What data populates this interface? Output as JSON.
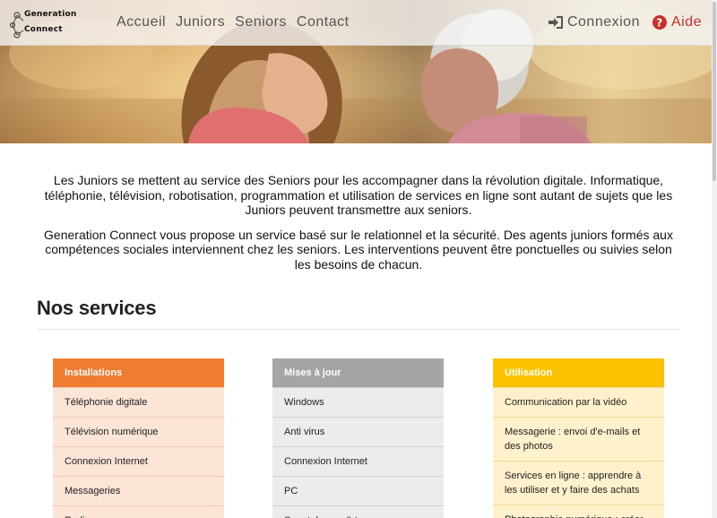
{
  "brand": {
    "line1": "Generation",
    "line2": "Connect"
  },
  "nav": {
    "items": [
      {
        "label": "Accueil"
      },
      {
        "label": "Juniors"
      },
      {
        "label": "Seniors"
      },
      {
        "label": "Contact"
      }
    ],
    "login": {
      "label": "Connexion",
      "icon": "sign-in-icon"
    },
    "help": {
      "label": "Aide",
      "icon": "question-circle-icon",
      "color": "#c9302c"
    }
  },
  "intro": {
    "paragraph1": "Les Juniors se mettent au service des Seniors pour les accompagner dans la révolution digitale. Informatique, téléphonie, télévision, robotisation, programmation et utilisation de services en ligne sont autant de sujets que les Juniors peuvent transmettre aux seniors.",
    "paragraph2": "Generation Connect vous propose un service basé sur le relationnel et la sécurité. Des agents juniors formés aux compétences sociales interviennent chez les seniors. Les interventions peuvent être ponctuelles ou suivies selon les besoins de chacun."
  },
  "services": {
    "title": "Nos services",
    "cards": [
      {
        "title": "Installations",
        "color": "#ef7c30",
        "items": [
          "Téléphonie digitale",
          "Télévision numérique",
          "Connexion Internet",
          "Messageries",
          "Radio"
        ]
      },
      {
        "title": "Mises à jour",
        "color": "#a5a5a5",
        "items": [
          "Windows",
          "Anti virus",
          "Connexion Internet",
          "PC",
          "Smartphones & tours"
        ]
      },
      {
        "title": "Utilisation",
        "color": "#fcc100",
        "items": [
          "Communication par la vidéo",
          "Messagerie : envoi d'e-mails et des photos",
          "Services en ligne : apprendre à les utiliser et y faire des achats",
          "Photographie numérique : créer"
        ]
      }
    ]
  }
}
